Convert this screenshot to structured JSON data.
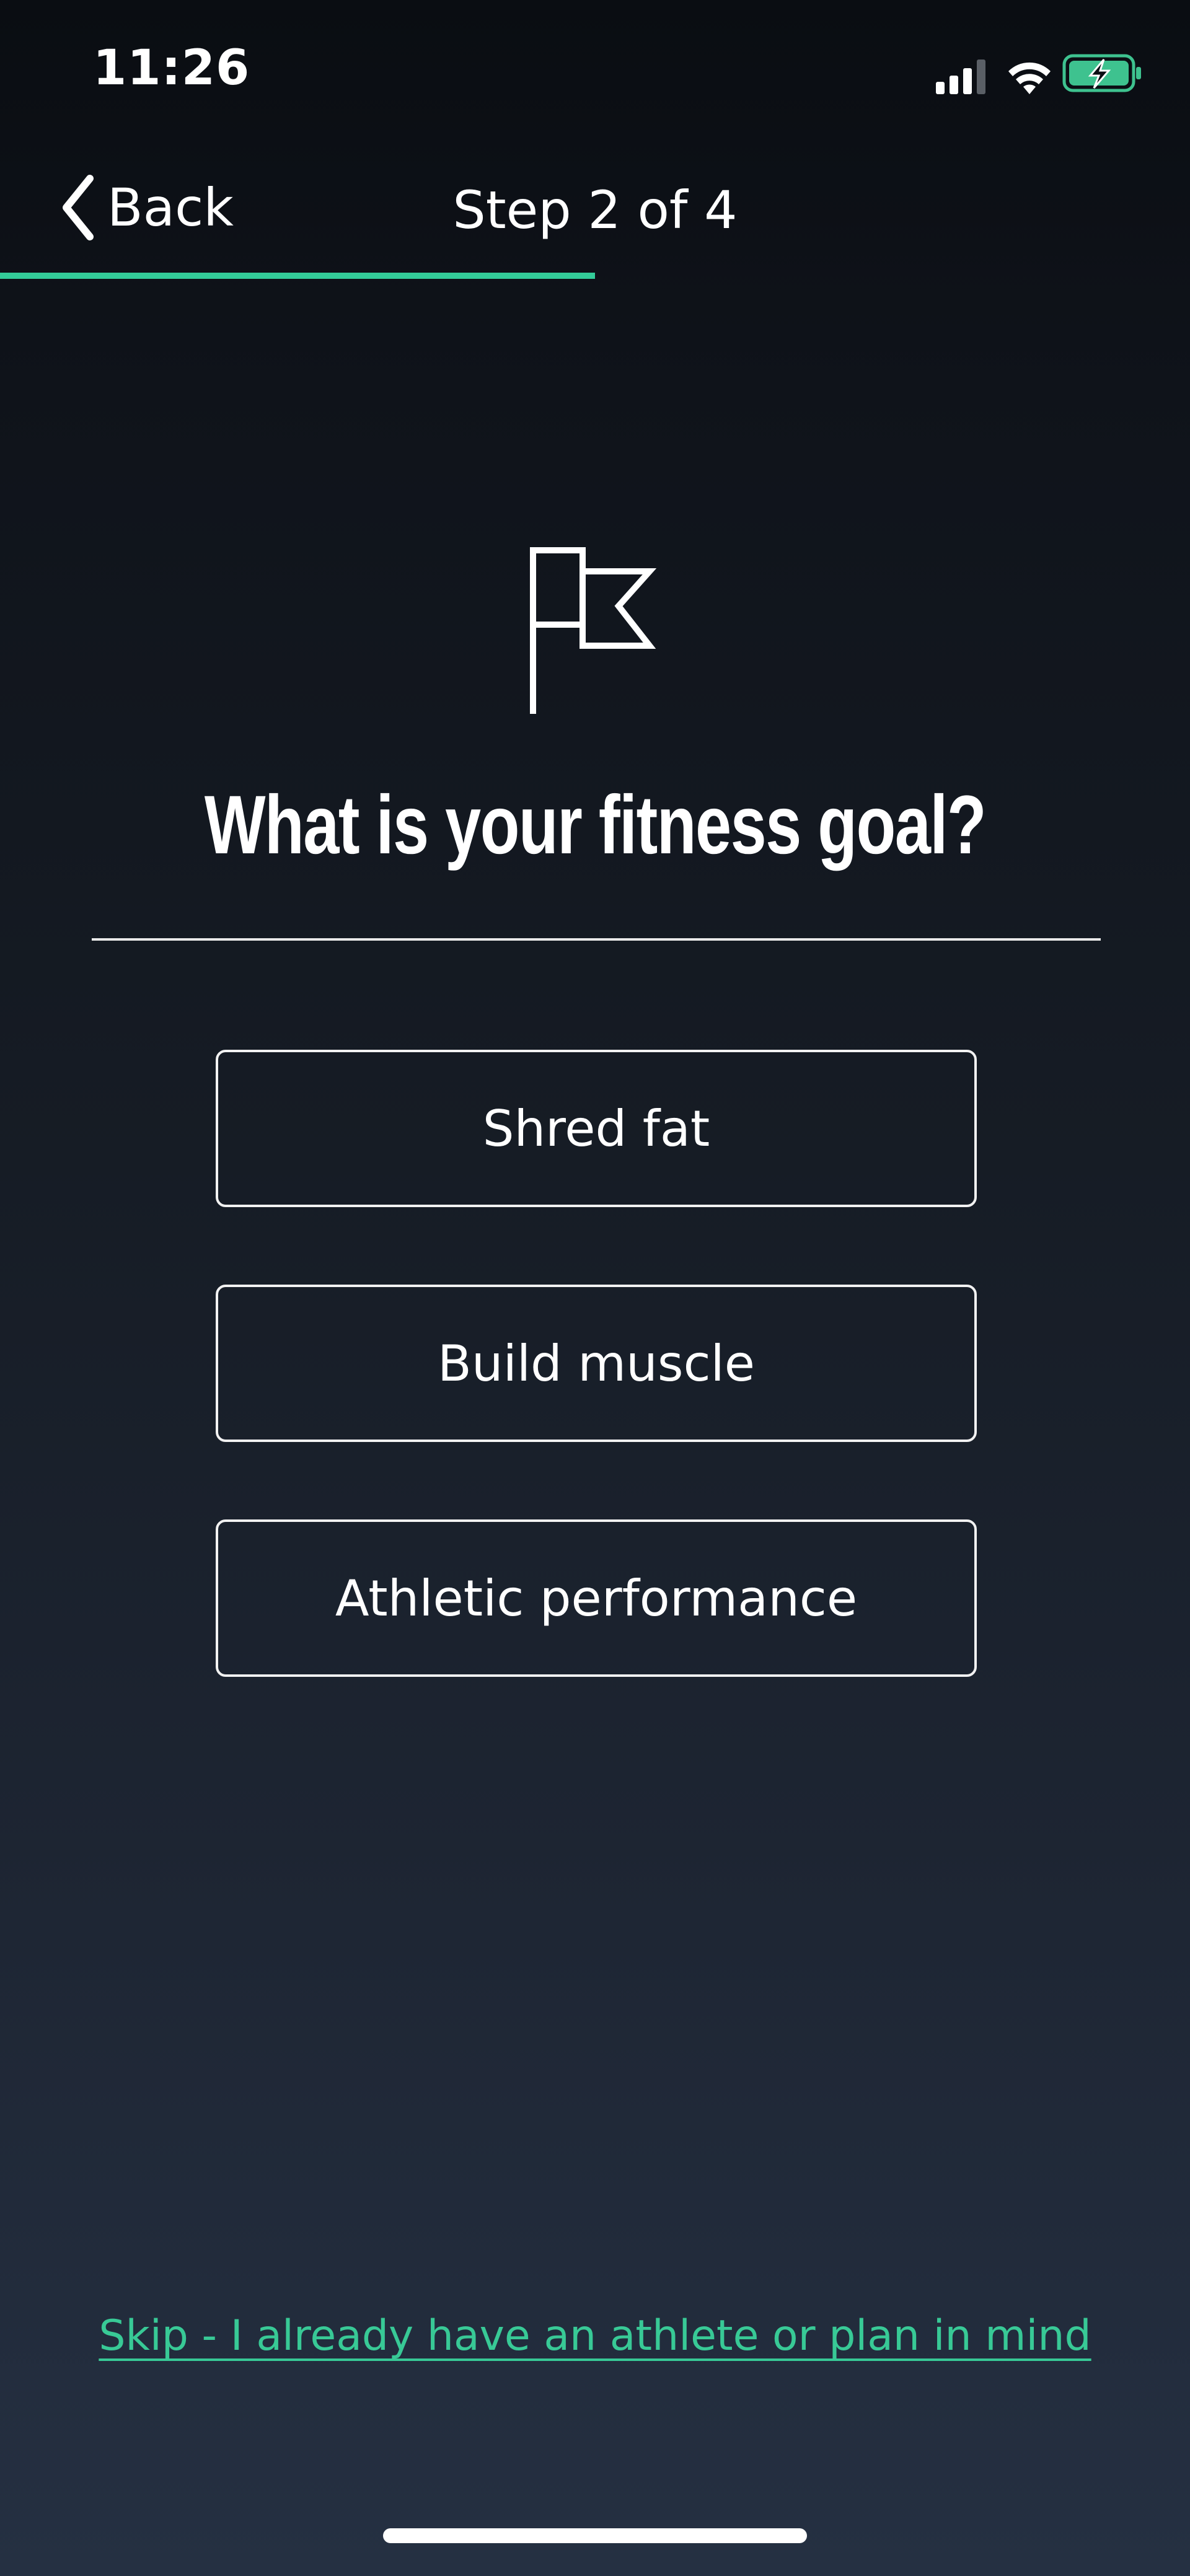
{
  "status_bar": {
    "time": "11:26",
    "icons": [
      "cellular-signal-icon",
      "wifi-icon",
      "battery-charging-icon"
    ],
    "battery_color": "#3ec28f"
  },
  "header": {
    "back_label": "Back",
    "step_label": "Step 2 of 4",
    "progress": 0.5,
    "progress_color": "#33cc99"
  },
  "main": {
    "icon": "flag-icon",
    "question": "What is your fitness goal?",
    "options": [
      {
        "label": "Shred fat"
      },
      {
        "label": "Build muscle"
      },
      {
        "label": "Athletic performance"
      }
    ]
  },
  "footer": {
    "skip_label": "Skip - I already have an athlete or plan in mind",
    "skip_color": "#38c996"
  }
}
